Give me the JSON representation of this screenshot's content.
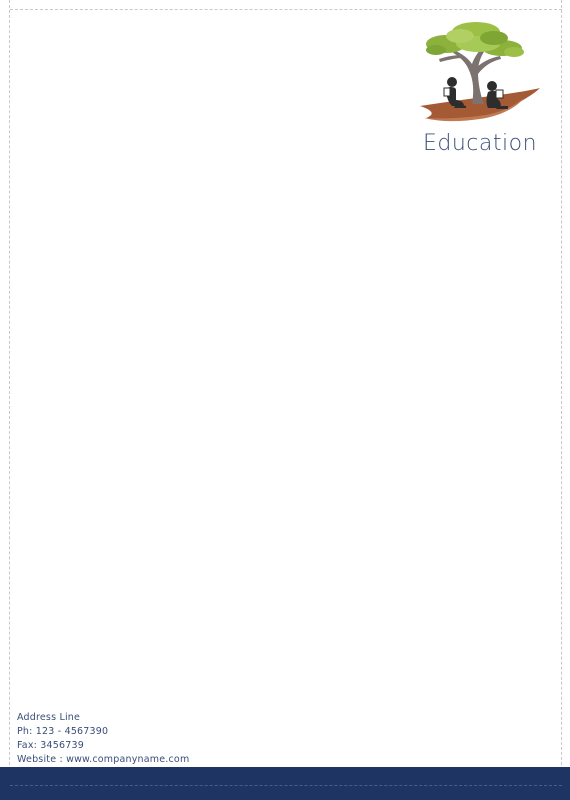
{
  "header": {
    "brand_name": "Education",
    "logo_icon": "tree-with-readers-icon"
  },
  "contact": {
    "address": "Address Line",
    "phone": "Ph: 123 - 4567390",
    "fax": "Fax: 3456739",
    "website": "Website : www.companyname.com"
  },
  "colors": {
    "brand_text": "#3a4e78",
    "footer_bar": "#1e3563",
    "tree_canopy": "#8db23c",
    "ground": "#a35a35"
  }
}
